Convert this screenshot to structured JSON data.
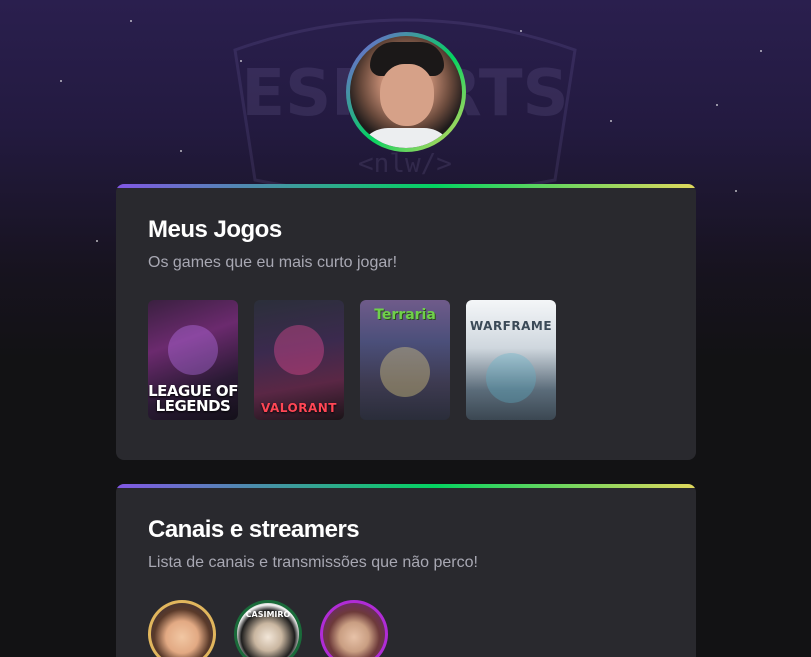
{
  "profile": {
    "avatar_icon": "user-avatar-photo"
  },
  "background": {
    "logo_text": "ESPORTS",
    "logo_sub": "<nlw/>"
  },
  "theme": {
    "gradient_start": "#8257e5",
    "gradient_mid": "#04d361",
    "gradient_end": "#e1d85d",
    "card_bg": "#29292e",
    "page_bg": "#121214"
  },
  "games_section": {
    "title": "Meus Jogos",
    "subtitle": "Os games que eu mais curto jogar!",
    "games": [
      {
        "name": "league-of-legends",
        "cover_text": "LEAGUE OF LEGENDS"
      },
      {
        "name": "valorant",
        "cover_text": "VALORANT"
      },
      {
        "name": "terraria",
        "cover_text": "Terraria"
      },
      {
        "name": "warframe",
        "cover_text": "WARFRAME"
      }
    ]
  },
  "channels_section": {
    "title": "Canais e streamers",
    "subtitle": "Lista de canais e transmissões que não perco!",
    "streamers": [
      {
        "name": "streamer-1",
        "ring_color": "#e1b65d"
      },
      {
        "name": "streamer-casimiro",
        "ring_color": "#1a6b3a",
        "badge_text": "CASIMIRO"
      },
      {
        "name": "streamer-3",
        "ring_color": "#b02cd6"
      }
    ]
  }
}
